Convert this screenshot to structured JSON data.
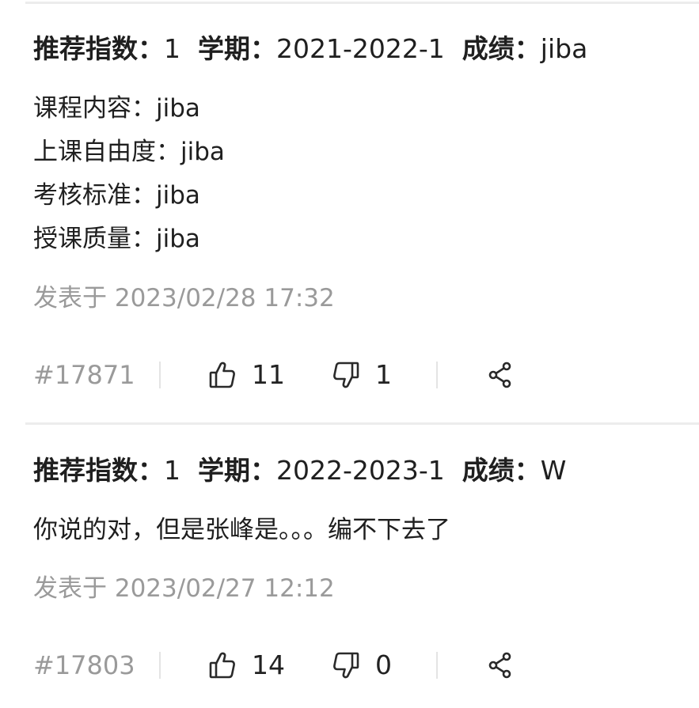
{
  "labels": {
    "rating": "推荐指数：",
    "semester": "学期：",
    "grade": "成绩：",
    "posted_prefix": "发表于"
  },
  "reviews": [
    {
      "rating": "1",
      "semester": "2021-2022-1",
      "grade": "jiba",
      "content_lines": [
        "课程内容：jiba",
        "上课自由度：jiba",
        "考核标准：jiba",
        "授课质量：jiba"
      ],
      "posted_at": "2023/02/28 17:32",
      "post_id": "#17871",
      "likes": "11",
      "dislikes": "1"
    },
    {
      "rating": "1",
      "semester": "2022-2023-1",
      "grade": "W",
      "content_lines": [
        "你说的对，但是张峰是。。。编不下去了"
      ],
      "posted_at": "2023/02/27 12:12",
      "post_id": "#17803",
      "likes": "14",
      "dislikes": "0"
    }
  ],
  "icons": {
    "like": "thumbs-up-icon",
    "dislike": "thumbs-down-icon",
    "share": "share-icon"
  },
  "colors": {
    "text": "#1f1f1f",
    "muted": "#9a9a9a",
    "divider": "#ececec"
  }
}
